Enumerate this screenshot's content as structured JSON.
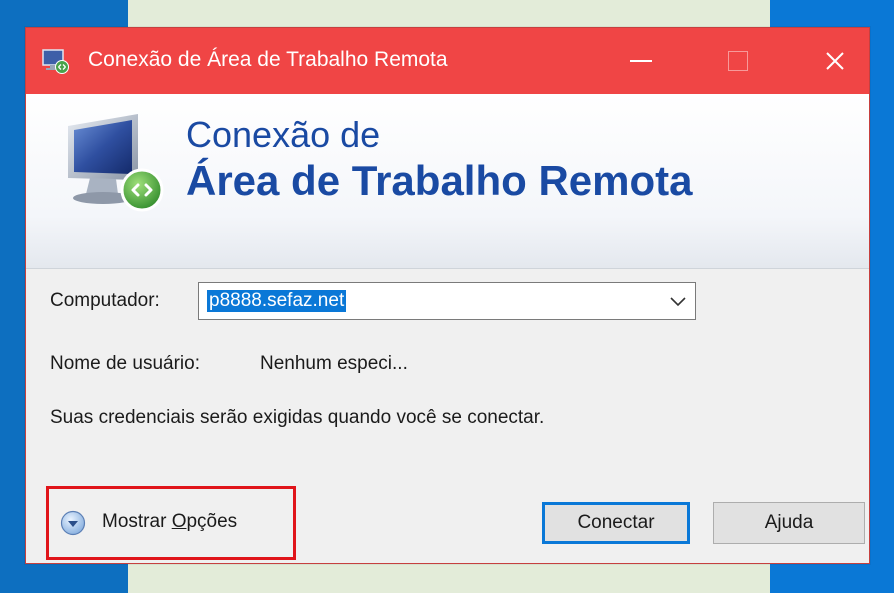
{
  "window": {
    "title": "Conexão de Área de Trabalho Remota",
    "minimize_symbol": "—",
    "close_symbol": "✕"
  },
  "banner": {
    "line1": "Conexão de",
    "line2": "Área de Trabalho Remota"
  },
  "form": {
    "computer_label": "Computador:",
    "computer_value": "p8888.sefaz.net",
    "username_label": "Nome de usuário:",
    "username_value": "Nenhum especi...",
    "credentials_text": "Suas credenciais serão exigidas quando você se conectar."
  },
  "footer": {
    "show_options_prefix": "Mostrar ",
    "show_options_underlined": "O",
    "show_options_suffix": "pções",
    "connect_label": "Conectar",
    "help_label": "Ajuda"
  },
  "icons": {
    "title_icon": "remote-desktop-icon",
    "banner_icon": "monitor-remote-icon",
    "combo_arrow": "chevron-down-icon",
    "options_icon": "expand-circle-icon"
  },
  "colors": {
    "titlebar": "#f04545",
    "highlight": "#e0141a",
    "accent": "#0a78d7",
    "banner_text": "#1a4aa3"
  }
}
